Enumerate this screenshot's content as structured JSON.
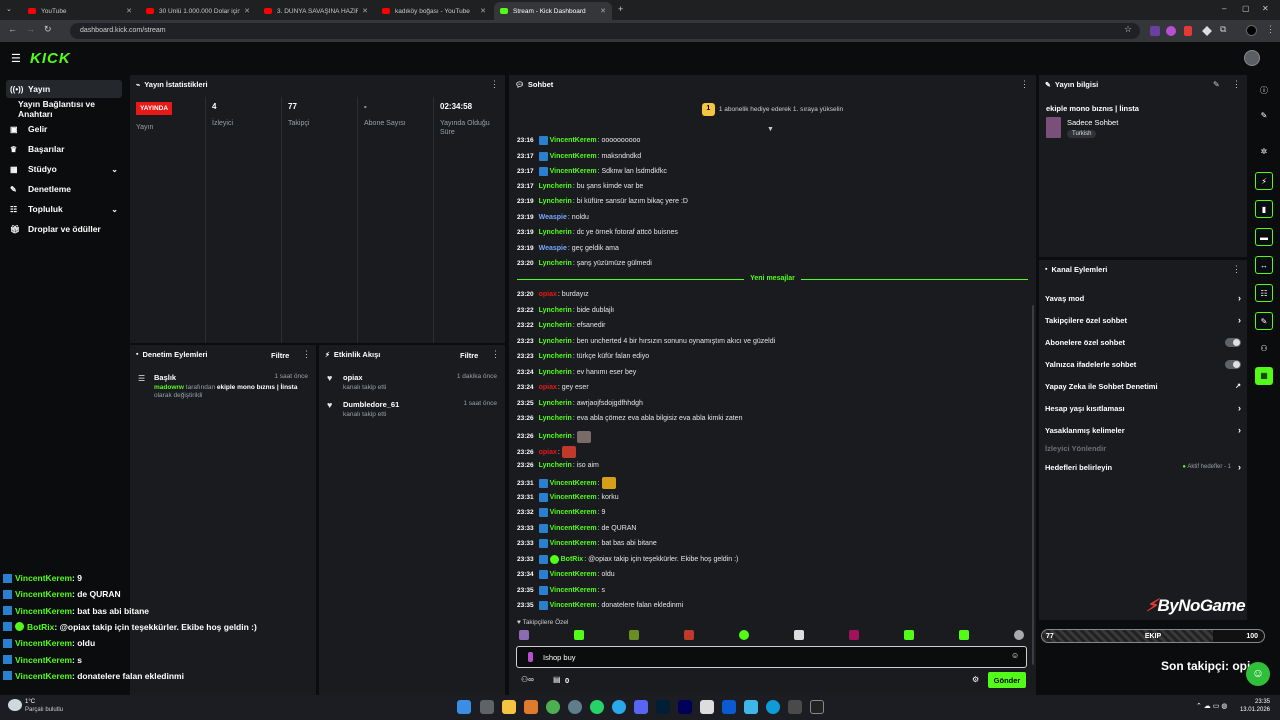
{
  "browser": {
    "tabs": [
      {
        "label": "YouTube",
        "active": false
      },
      {
        "label": "30 Ünlü 1.000.000 Dolar için Yu",
        "active": false
      },
      {
        "label": "3. DÜNYA SAVAŞINA HAZIR DE",
        "active": false
      },
      {
        "label": "kadıköy boğası - YouTube",
        "active": false
      },
      {
        "label": "Stream - Kick Dashboard",
        "active": true
      }
    ],
    "url": "dashboard.kick.com/stream"
  },
  "header": {
    "logo": "KICK"
  },
  "sidebar": {
    "items": [
      {
        "label": "Yayın",
        "icon": "broadcast-icon",
        "active": true
      },
      {
        "label": "Yayın Bağlantısı ve Anahtarı",
        "icon": "",
        "active": false
      },
      {
        "label": "Gelir",
        "icon": "wallet-icon",
        "active": false
      },
      {
        "label": "Başarılar",
        "icon": "trophy-icon",
        "active": false
      },
      {
        "label": "Stüdyo",
        "icon": "studio-icon",
        "active": false,
        "expandable": true
      },
      {
        "label": "Denetleme",
        "icon": "wrench-icon",
        "active": false
      },
      {
        "label": "Topluluk",
        "icon": "community-icon",
        "active": false,
        "expandable": true
      },
      {
        "label": "Droplar ve ödüller",
        "icon": "gift-icon",
        "active": false
      }
    ]
  },
  "stats": {
    "title": "Yayın İstatistikleri",
    "live_badge": "YAYINDA",
    "live_label": "Yayın",
    "viewers_value": "4",
    "viewers_label": "İzleyici",
    "followers_value": "77",
    "followers_label": "Takipçi",
    "subs_value": "-",
    "subs_label": "Abone Sayısı",
    "uptime_value": "02:34:58",
    "uptime_label": "Yayında Olduğu Süre"
  },
  "moderation": {
    "title": "Denetim Eylemleri",
    "filter": "Filtre",
    "item": {
      "title": "Başlık",
      "time": "1 saat önce",
      "user": "madowrw",
      "mid": " tarafından ",
      "value": "ekiple mono bıznıs | İinsta",
      "tail": " olarak değiştirildi"
    }
  },
  "activity": {
    "title": "Etkinlik Akışı",
    "filter": "Filtre",
    "items": [
      {
        "user": "opiax",
        "desc": "kanalı takip etti",
        "time": "1 dakika önce"
      },
      {
        "user": "Dumbledore_61",
        "desc": "kanalı takip etti",
        "time": "1 saat önce"
      }
    ]
  },
  "chat": {
    "title": "Sohbet",
    "gift_banner": "1 abonelik hediye ederek 1. sıraya yükselin",
    "gift_rank": "1",
    "new_messages": "Yeni mesajlar",
    "messages": [
      {
        "time": "23:16",
        "user": "VincentKerem",
        "color": "#53fc18",
        "badge": true,
        "text": ": oooooooooo"
      },
      {
        "time": "23:17",
        "user": "VincentKerem",
        "color": "#53fc18",
        "badge": true,
        "text": ": maksndndkd"
      },
      {
        "time": "23:17",
        "user": "VincentKerem",
        "color": "#53fc18",
        "badge": true,
        "text": ": Sdknw lan lsdmdkfkc"
      },
      {
        "time": "23:17",
        "user": "Lyncherin",
        "color": "#53fc18",
        "badge": false,
        "text": ": bu şans kimde var be"
      },
      {
        "time": "23:19",
        "user": "Lyncherin",
        "color": "#53fc18",
        "badge": false,
        "text": ": bi küfüre sansür lazım bikaç yere :D"
      },
      {
        "time": "23:19",
        "user": "Weaspie",
        "color": "#7aa7ff",
        "badge": false,
        "text": ": noldu"
      },
      {
        "time": "23:19",
        "user": "Lyncherin",
        "color": "#53fc18",
        "badge": false,
        "text": ": dc ye örnek fotoraf attcö buisnes"
      },
      {
        "time": "23:19",
        "user": "Weaspie",
        "color": "#7aa7ff",
        "badge": false,
        "text": ": geç geldik ama"
      },
      {
        "time": "23:20",
        "user": "Lyncherin",
        "color": "#53fc18",
        "badge": false,
        "text": ": şanş yüzümüze gülmedi"
      },
      {
        "time": "23:20",
        "user": "opiax",
        "color": "#e91916",
        "badge": false,
        "text": ": burdayız"
      },
      {
        "time": "23:22",
        "user": "Lyncherin",
        "color": "#53fc18",
        "badge": false,
        "text": ": bide dublajlı"
      },
      {
        "time": "23:22",
        "user": "Lyncherin",
        "color": "#53fc18",
        "badge": false,
        "text": ": efsanedir"
      },
      {
        "time": "23:23",
        "user": "Lyncherin",
        "color": "#53fc18",
        "badge": false,
        "text": ": ben uncherted 4 bir hırsızın sonunu oynamıştım akıcı ve güzeldi"
      },
      {
        "time": "23:23",
        "user": "Lyncherin",
        "color": "#53fc18",
        "badge": false,
        "text": ": türkçe küfür falan ediyo"
      },
      {
        "time": "23:24",
        "user": "Lyncherin",
        "color": "#53fc18",
        "badge": false,
        "text": ": ev hanımı eser bey"
      },
      {
        "time": "23:24",
        "user": "opiax",
        "color": "#e91916",
        "badge": false,
        "text": ": gey eser"
      },
      {
        "time": "23:25",
        "user": "Lyncherin",
        "color": "#53fc18",
        "badge": false,
        "text": ": awrjaojfsdojgdfhhdgh"
      },
      {
        "time": "23:26",
        "user": "Lyncherin",
        "color": "#53fc18",
        "badge": false,
        "text": ": eva abla çömez eva abla bilgisiz eva abla kimki zaten"
      },
      {
        "time": "23:26",
        "user": "Lyncherin",
        "color": "#53fc18",
        "badge": false,
        "text": ":",
        "emote": "#7a6a6a"
      },
      {
        "time": "23:26",
        "user": "opiax",
        "color": "#e91916",
        "badge": false,
        "text": ":",
        "emote": "#c0392b"
      },
      {
        "time": "23:26",
        "user": "Lyncherin",
        "color": "#53fc18",
        "badge": false,
        "text": ": iso aim"
      },
      {
        "time": "23:31",
        "user": "VincentKerem",
        "color": "#53fc18",
        "badge": true,
        "text": ":",
        "emote": "#d4a017"
      },
      {
        "time": "23:31",
        "user": "VincentKerem",
        "color": "#53fc18",
        "badge": true,
        "text": ": korku"
      },
      {
        "time": "23:32",
        "user": "VincentKerem",
        "color": "#53fc18",
        "badge": true,
        "text": ": 9"
      },
      {
        "time": "23:33",
        "user": "VincentKerem",
        "color": "#53fc18",
        "badge": true,
        "text": ": de QURAN"
      },
      {
        "time": "23:33",
        "user": "VincentKerem",
        "color": "#53fc18",
        "badge": true,
        "text": ": bat bas abi bitane"
      },
      {
        "time": "23:33",
        "user": "BotRix",
        "color": "#53fc18",
        "badge": true,
        "bot": true,
        "text": ": @opiax takip için teşekkürler. Ekibe hoş geldin :)"
      },
      {
        "time": "23:34",
        "user": "VincentKerem",
        "color": "#53fc18",
        "badge": true,
        "text": ": oldu"
      },
      {
        "time": "23:35",
        "user": "VincentKerem",
        "color": "#53fc18",
        "badge": true,
        "text": ": s"
      },
      {
        "time": "23:35",
        "user": "VincentKerem",
        "color": "#53fc18",
        "badge": true,
        "text": ": donatelere falan ekledinmi"
      }
    ],
    "followers_only": "Takipçilere Özel",
    "input_value": "Ishop buy",
    "points": "0",
    "send": "Gönder"
  },
  "stream_info": {
    "title": "Yayın bilgisi",
    "stream_title": "ekiple mono bıznıs | İinsta",
    "category": "Sadece Sohbet",
    "language": "Turkish"
  },
  "channel_actions": {
    "title": "Kanal Eylemleri",
    "items": [
      {
        "label": "Yavaş mod",
        "type": "chevron"
      },
      {
        "label": "Takipçilere özel sohbet",
        "type": "chevron"
      },
      {
        "label": "Abonelere özel sohbet",
        "type": "toggle"
      },
      {
        "label": "Yalnızca ifadelerle sohbet",
        "type": "toggle"
      },
      {
        "label": "Yapay Zeka ile Sohbet Denetimi",
        "type": "external"
      },
      {
        "label": "Hesap yaşı kısıtlaması",
        "type": "chevron"
      },
      {
        "label": "Yasaklanmış kelimeler",
        "type": "chevron"
      },
      {
        "label": "İzleyici Yönlendir",
        "type": "disabled"
      },
      {
        "label": "Hedefleri belirleyin",
        "type": "goal",
        "extra": "Aktif hedefler - 1"
      }
    ]
  },
  "overlay": {
    "brand": "ByNoGame",
    "goal_current": "77",
    "goal_label": "EKIP",
    "goal_target": "100",
    "goal_progress": 0.77,
    "last_follower": "Son takipçi: opiax",
    "chat": [
      {
        "user": "VincentKerem",
        "text": " : 9"
      },
      {
        "user": "VincentKerem",
        "text": " : de QURAN"
      },
      {
        "user": "VincentKerem",
        "text": " : bat bas abi bitane"
      },
      {
        "user": "BotRix",
        "text": " : @opiax takip için teşekkürler. Ekibe hoş geldin :)"
      },
      {
        "user": "VincentKerem",
        "text": " : oldu"
      },
      {
        "user": "VincentKerem",
        "text": " : s"
      },
      {
        "user": "VincentKerem",
        "text": " : donatelere falan ekledinmi"
      }
    ]
  },
  "taskbar": {
    "weather_temp": "1°C",
    "weather_desc": "Parçalı bulutlu",
    "time": "23:35",
    "date": "13.01.2026"
  }
}
